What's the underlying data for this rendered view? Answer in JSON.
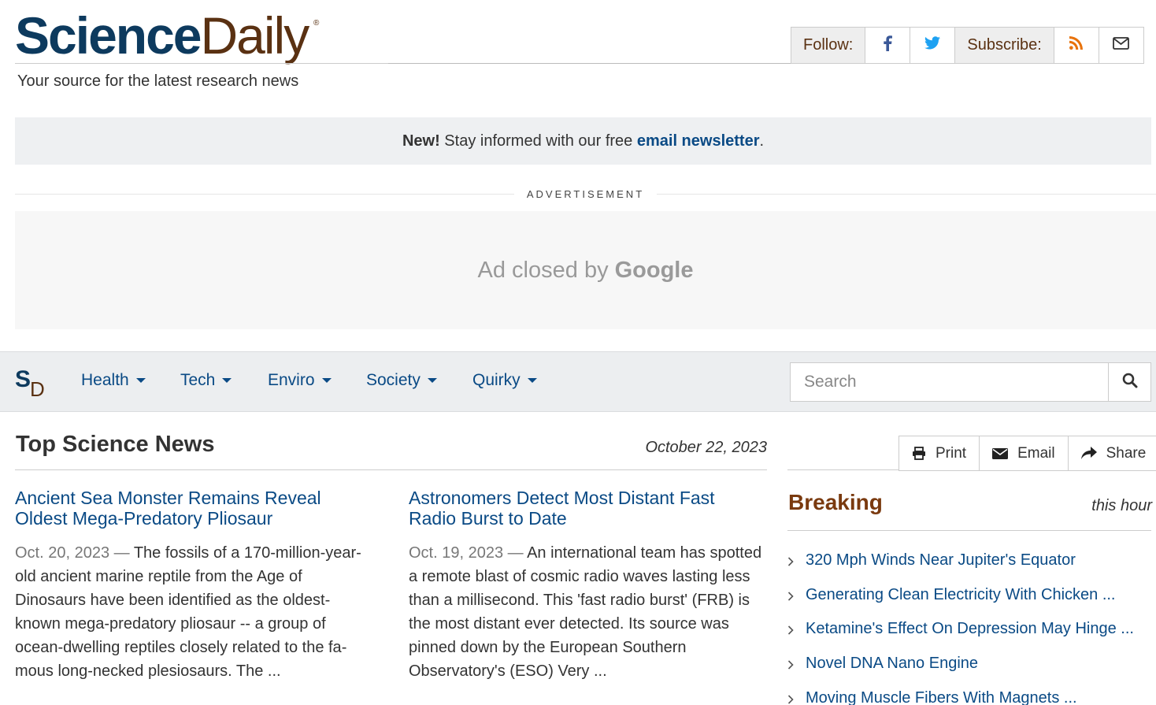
{
  "header": {
    "logo_science": "Science",
    "logo_daily": "Daily",
    "logo_reg": "®",
    "tagline": "Your source for the latest research news",
    "follow_label": "Follow:",
    "subscribe_label": "Subscribe:",
    "icons": [
      "facebook-icon",
      "twitter-icon",
      "rss-icon",
      "envelope-icon"
    ],
    "colors": {
      "brand_blue": "#0d3a5e",
      "brand_brown": "#5a3112",
      "link": "#0a4a85",
      "rss": "#e8730c",
      "twitter": "#1da1f2",
      "facebook": "#3b5998"
    }
  },
  "newsletter": {
    "new": "New!",
    "text": " Stay informed with our free ",
    "link": "email newsletter",
    "end": "."
  },
  "ad": {
    "label": "ADVERTISEMENT",
    "closed_text": "Ad closed by",
    "google": "Google"
  },
  "nav": {
    "logo_s": "S",
    "logo_d": "D",
    "items": [
      {
        "label": "Health"
      },
      {
        "label": "Tech"
      },
      {
        "label": "Enviro"
      },
      {
        "label": "Society"
      },
      {
        "label": "Quirky"
      }
    ],
    "search_placeholder": "Search"
  },
  "main": {
    "title": "Top Science News",
    "date": "October 22, 2023",
    "stories": [
      {
        "headline": "Ancient Sea Monster Remains Reveal Oldest Mega-Predatory Pliosaur",
        "date": "Oct. 20, 2023",
        "sep": " — ",
        "summary": "The fossils of a 170-million-year-old ancient marine reptile from the Age of Dinosaurs have been identified as the oldest-known mega-predatory pliosaur -- a group of ocean-dwelling reptiles closely related to the fa­mous long-necked plesiosaurs. The ..."
      },
      {
        "headline": "Astronomers Detect Most Distant Fast Radio Burst to Date",
        "date": "Oct. 19, 2023",
        "sep": " — ",
        "summary": "An international team has spot­ted a remote blast of cosmic radio waves lasting less than a millisecond. This 'fast radio burst' (FRB) is the most distant ever detected. Its source was pinned down by the European Southern Observatory's (ESO) Very ..."
      }
    ]
  },
  "sidebar": {
    "tools": [
      {
        "label": "Print",
        "icon": "print-icon"
      },
      {
        "label": "Email",
        "icon": "envelope-icon"
      },
      {
        "label": "Share",
        "icon": "share-icon"
      }
    ],
    "breaking_title": "Breaking",
    "breaking_when": "this hour",
    "breaking": [
      "320 Mph Winds Near Jupiter's Equator",
      "Generating Clean Electricity With Chicken ...",
      "Ketamine's Effect On Depression May Hinge ...",
      "Novel DNA Nano Engine",
      "Moving Muscle Fibers With Magnets ..."
    ]
  }
}
